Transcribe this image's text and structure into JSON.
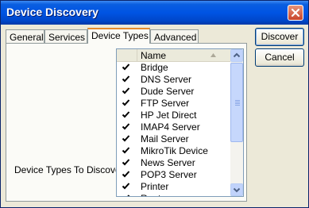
{
  "window": {
    "title": "Device Discovery"
  },
  "tabs": [
    {
      "label": "General"
    },
    {
      "label": "Services"
    },
    {
      "label": "Device Types"
    },
    {
      "label": "Advanced"
    }
  ],
  "active_tab": "Device Types",
  "panel": {
    "label": "Device Types To Discover:"
  },
  "list": {
    "column_header": "Name",
    "items": [
      {
        "name": "Bridge",
        "checked": true
      },
      {
        "name": "DNS Server",
        "checked": true
      },
      {
        "name": "Dude Server",
        "checked": true
      },
      {
        "name": "FTP Server",
        "checked": true
      },
      {
        "name": "HP Jet Direct",
        "checked": true
      },
      {
        "name": "IMAP4 Server",
        "checked": true
      },
      {
        "name": "Mail Server",
        "checked": true
      },
      {
        "name": "MikroTik Device",
        "checked": true
      },
      {
        "name": "News Server",
        "checked": true
      },
      {
        "name": "POP3 Server",
        "checked": true
      },
      {
        "name": "Printer",
        "checked": true
      },
      {
        "name": "Router",
        "checked": true
      }
    ]
  },
  "buttons": {
    "discover": "Discover",
    "cancel": "Cancel"
  }
}
